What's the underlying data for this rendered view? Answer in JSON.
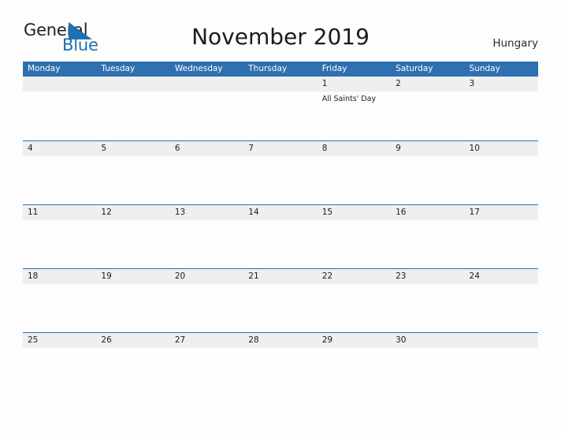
{
  "brand": {
    "name_part1": "General",
    "name_part2": "Blue",
    "triangle_color": "#1f6fb2",
    "text_color": "#231f20",
    "blue_color": "#1f6fb2"
  },
  "header": {
    "title": "November 2019",
    "country": "Hungary"
  },
  "colors": {
    "header_blue": "#2e70b0",
    "row_rule_blue": "#2e70b0",
    "date_band_gray": "#efefef",
    "page_background": "#fdfdfd",
    "text_dark": "#1d1d1d",
    "header_text": "#ffffff"
  },
  "calendar": {
    "month": "November",
    "year": "2019",
    "weekdays": [
      "Monday",
      "Tuesday",
      "Wednesday",
      "Thursday",
      "Friday",
      "Saturday",
      "Sunday"
    ],
    "weeks": [
      [
        {
          "day": "",
          "event": ""
        },
        {
          "day": "",
          "event": ""
        },
        {
          "day": "",
          "event": ""
        },
        {
          "day": "",
          "event": ""
        },
        {
          "day": "1",
          "event": "All Saints' Day"
        },
        {
          "day": "2",
          "event": ""
        },
        {
          "day": "3",
          "event": ""
        }
      ],
      [
        {
          "day": "4",
          "event": ""
        },
        {
          "day": "5",
          "event": ""
        },
        {
          "day": "6",
          "event": ""
        },
        {
          "day": "7",
          "event": ""
        },
        {
          "day": "8",
          "event": ""
        },
        {
          "day": "9",
          "event": ""
        },
        {
          "day": "10",
          "event": ""
        }
      ],
      [
        {
          "day": "11",
          "event": ""
        },
        {
          "day": "12",
          "event": ""
        },
        {
          "day": "13",
          "event": ""
        },
        {
          "day": "14",
          "event": ""
        },
        {
          "day": "15",
          "event": ""
        },
        {
          "day": "16",
          "event": ""
        },
        {
          "day": "17",
          "event": ""
        }
      ],
      [
        {
          "day": "18",
          "event": ""
        },
        {
          "day": "19",
          "event": ""
        },
        {
          "day": "20",
          "event": ""
        },
        {
          "day": "21",
          "event": ""
        },
        {
          "day": "22",
          "event": ""
        },
        {
          "day": "23",
          "event": ""
        },
        {
          "day": "24",
          "event": ""
        }
      ],
      [
        {
          "day": "25",
          "event": ""
        },
        {
          "day": "26",
          "event": ""
        },
        {
          "day": "27",
          "event": ""
        },
        {
          "day": "28",
          "event": ""
        },
        {
          "day": "29",
          "event": ""
        },
        {
          "day": "30",
          "event": ""
        },
        {
          "day": "",
          "event": ""
        }
      ]
    ]
  }
}
